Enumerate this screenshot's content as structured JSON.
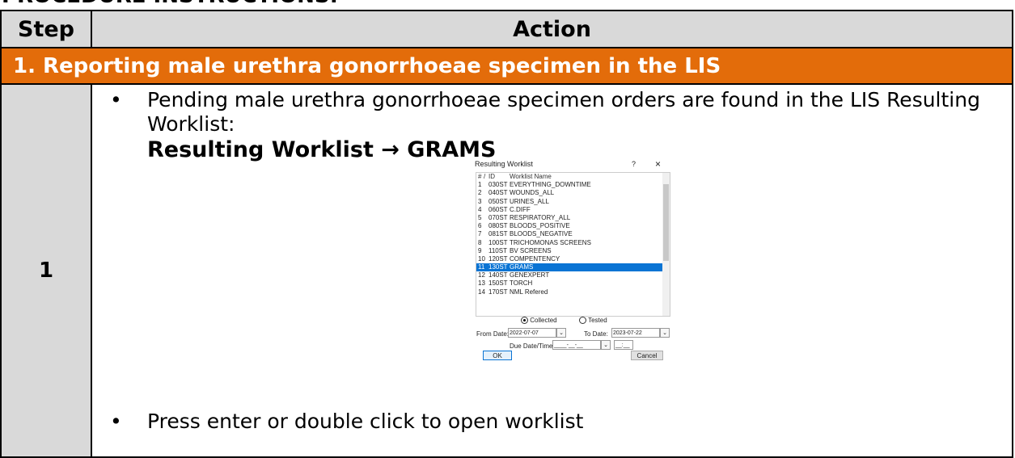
{
  "cut_heading": "PROCEDURE INSTRUCTIONS:",
  "table": {
    "col_step": "Step",
    "col_action": "Action",
    "section_title": "1. Reporting male urethra gonorrhoeae specimen in the LIS",
    "step_number": "1",
    "bullet1": "Pending male urethra gonorrhoeae specimen orders are found in the LIS Resulting Worklist:",
    "bullet_glyph": "•",
    "path": "Resulting Worklist → GRAMS",
    "bullet2": "Press enter or double click to open worklist"
  },
  "dialog": {
    "title": "Resulting Worklist",
    "help": "?",
    "close": "×",
    "headers": {
      "num": "#",
      "id": "ID",
      "name": "Worklist Name",
      "sort": "/"
    },
    "rows": [
      {
        "num": "1",
        "id": "030ST",
        "name": "EVERYTHING_DOWNTIME"
      },
      {
        "num": "2",
        "id": "040ST",
        "name": "WOUNDS_ALL"
      },
      {
        "num": "3",
        "id": "050ST",
        "name": "URINES_ALL"
      },
      {
        "num": "4",
        "id": "060ST",
        "name": "C.DIFF"
      },
      {
        "num": "5",
        "id": "070ST",
        "name": "RESPIRATORY_ALL"
      },
      {
        "num": "6",
        "id": "080ST",
        "name": "BLOODS_POSITIVE"
      },
      {
        "num": "7",
        "id": "081ST",
        "name": "BLOODS_NEGATIVE"
      },
      {
        "num": "8",
        "id": "100ST",
        "name": "TRICHOMONAS SCREENS"
      },
      {
        "num": "9",
        "id": "110ST",
        "name": "BV SCREENS"
      },
      {
        "num": "10",
        "id": "120ST",
        "name": "COMPENTENCY"
      },
      {
        "num": "11",
        "id": "130ST",
        "name": "GRAMS"
      },
      {
        "num": "12",
        "id": "140ST",
        "name": "GENEXPERT"
      },
      {
        "num": "13",
        "id": "150ST",
        "name": "TORCH"
      },
      {
        "num": "14",
        "id": "170ST",
        "name": "NML Refered"
      }
    ],
    "selected_row": 10,
    "radio_collected": "Collected",
    "radio_tested": "Tested",
    "from_label": "From Date:",
    "from_value": "2022-07-07",
    "to_label": "To Date:",
    "to_value": "2023-07-22",
    "due_label": "Due Date/Time:",
    "due_date_value": "____-__-__",
    "due_time_value": "__:__",
    "ok": "OK",
    "cancel": "Cancel",
    "colors": {
      "selection": "#0a74d4",
      "section_bg": "#e36c0a",
      "header_bg": "#d9d9d9"
    }
  }
}
